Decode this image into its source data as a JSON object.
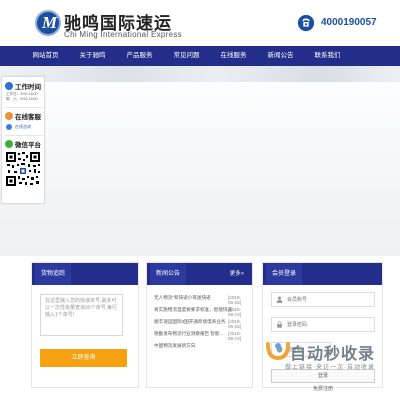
{
  "header": {
    "logo_letter": "M",
    "brand_cn": "驰鸣国际速运",
    "brand_en": "Chi Ming International Express",
    "phone": "4000190057"
  },
  "nav": {
    "items": [
      "网站首页",
      "关于驰鸣",
      "产品服务",
      "常见问题",
      "在线服务",
      "新闻公告",
      "联系我们"
    ]
  },
  "side": {
    "work_time_title": "工作时间",
    "work_time_lines": [
      "工作日：9:00-18:00",
      "周　六：9:00-18:00"
    ],
    "service_title": "在线客服",
    "service_label": "在线咨询",
    "wechat_title": "微信平台"
  },
  "query": {
    "title": "货物追踪",
    "placeholder": "在这里输入您的快递单号,最多可以一次性批量查询30个单号,每行输入1个单号!",
    "button": "立即查询"
  },
  "news": {
    "title": "新闻公告",
    "more": "更多>",
    "items": [
      {
        "title": "无人物流”和快递小哥送快递",
        "date": "[2018-06-15]"
      },
      {
        "title": "将实施物流温度要要求标准，智能快递...",
        "date": "[2018-06-15]"
      },
      {
        "title": "顺丰速运国际3国开通跨境电商业务",
        "date": "[2018-06-15]"
      },
      {
        "title": "德勤发布物流行业洞察报告 智能...",
        "date": "[2018-06-15]"
      },
      {
        "title": "中国物流发展新方向",
        "date": "[2018-06-15]"
      }
    ]
  },
  "member": {
    "title": "会员登录",
    "username_placeholder": "会员账号",
    "password_placeholder": "登录密码",
    "code_placeholder": "验证码",
    "login_button": "登录",
    "register_link": "免费注册"
  },
  "watermark": {
    "main": "自动秒收录",
    "sub": "做上链接·来访一次·自动收录"
  },
  "colors": {
    "nav_bg": "#232e8a",
    "accent_blue": "#1b4fa3",
    "button_orange": "#f5a112"
  }
}
